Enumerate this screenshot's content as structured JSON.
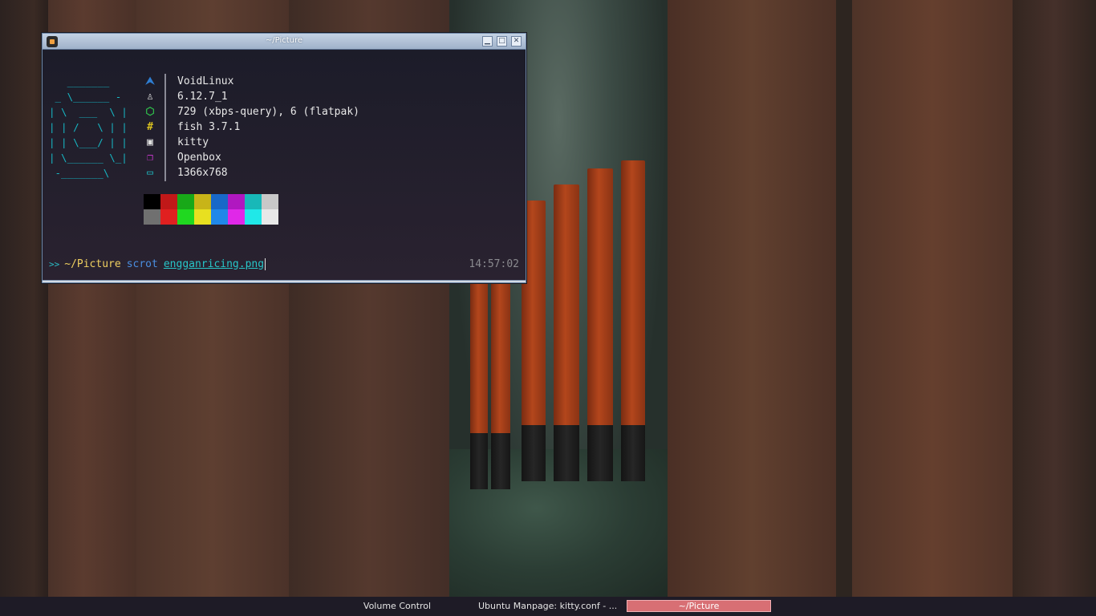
{
  "window": {
    "title": "~/Picture",
    "buttons": {
      "minimize": "▁",
      "maximize": "□",
      "close": "✕"
    }
  },
  "fetch": {
    "ascii_art": [
      "   _______",
      " _ \\______ -",
      "| \\  ___  \\ |",
      "| | /   \\ | |",
      "| | \\___/ | |",
      "| \\______ \\_|",
      " -_______\\"
    ],
    "rows": [
      {
        "icon": "arch-logo-icon",
        "glyph": "⮝",
        "color": "#2e7dd1",
        "text": "VoidLinux"
      },
      {
        "icon": "linux-tux-icon",
        "glyph": "♙",
        "color": "#e0e0e0",
        "text": "6.12.7_1"
      },
      {
        "icon": "package-cube-icon",
        "glyph": "⬡",
        "color": "#2fb84a",
        "text": "729 (xbps-query), 6 (flatpak)"
      },
      {
        "icon": "hash-shell-icon",
        "glyph": "#",
        "color": "#d8c020",
        "text": "fish 3.7.1"
      },
      {
        "icon": "terminal-prompt-icon",
        "glyph": "▣",
        "color": "#e0e0e0",
        "text": "kitty"
      },
      {
        "icon": "windows-stack-icon",
        "glyph": "❐",
        "color": "#d33ad8",
        "text": "Openbox"
      },
      {
        "icon": "monitor-icon",
        "glyph": "▭",
        "color": "#1fc1c8",
        "text": "1366x768"
      }
    ],
    "palette_top": [
      "#000000",
      "#c01818",
      "#18a818",
      "#c8b418",
      "#1868c8",
      "#b018c0",
      "#18b8b8",
      "#c8c8c8"
    ],
    "palette_bottom": [
      "#707070",
      "#e02020",
      "#20d820",
      "#e8e020",
      "#2088e8",
      "#e028e8",
      "#20e8e8",
      "#e8e8e8"
    ]
  },
  "prompt": {
    "arrows": ">>",
    "directory": "~/Picture",
    "command": "scrot",
    "argument": "engganricing.png",
    "time": "14:57:02"
  },
  "taskbar": {
    "items": [
      {
        "label": "Volume Control",
        "active": false
      },
      {
        "label": "Ubuntu Manpage: kitty.conf - ...",
        "active": false
      },
      {
        "label": "~/Picture",
        "active": true
      }
    ]
  }
}
